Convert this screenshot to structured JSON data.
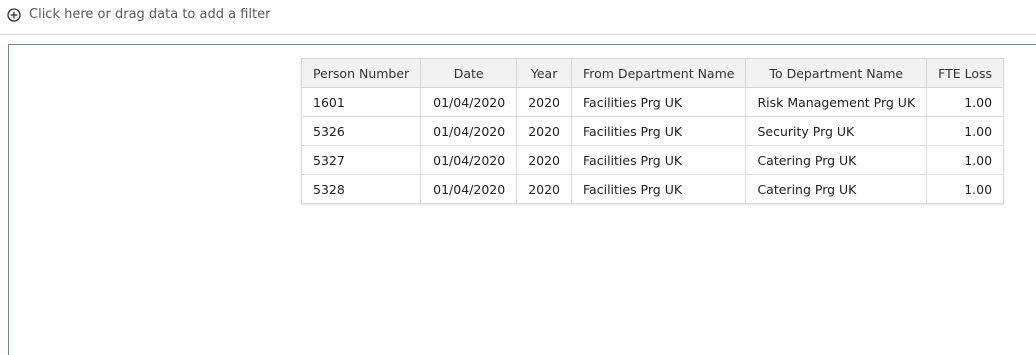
{
  "filter_bar": {
    "prompt": "Click here or drag data to add a filter",
    "icon": "plus-circle-icon"
  },
  "table": {
    "headers": [
      "Person Number",
      "Date",
      "Year",
      "From Department Name",
      "To Department Name",
      "FTE Loss"
    ],
    "rows": [
      [
        "1601",
        "01/04/2020",
        "2020",
        "Facilities Prg UK",
        "Risk Management Prg UK",
        "1.00"
      ],
      [
        "5326",
        "01/04/2020",
        "2020",
        "Facilities Prg UK",
        "Security Prg UK",
        "1.00"
      ],
      [
        "5327",
        "01/04/2020",
        "2020",
        "Facilities Prg UK",
        "Catering Prg UK",
        "1.00"
      ],
      [
        "5328",
        "01/04/2020",
        "2020",
        "Facilities Prg UK",
        "Catering Prg UK",
        "1.00"
      ]
    ]
  },
  "colors": {
    "header_bg": "#f2f2f2",
    "border": "#d6d6d6",
    "canvas_border": "#6d8aa0"
  }
}
